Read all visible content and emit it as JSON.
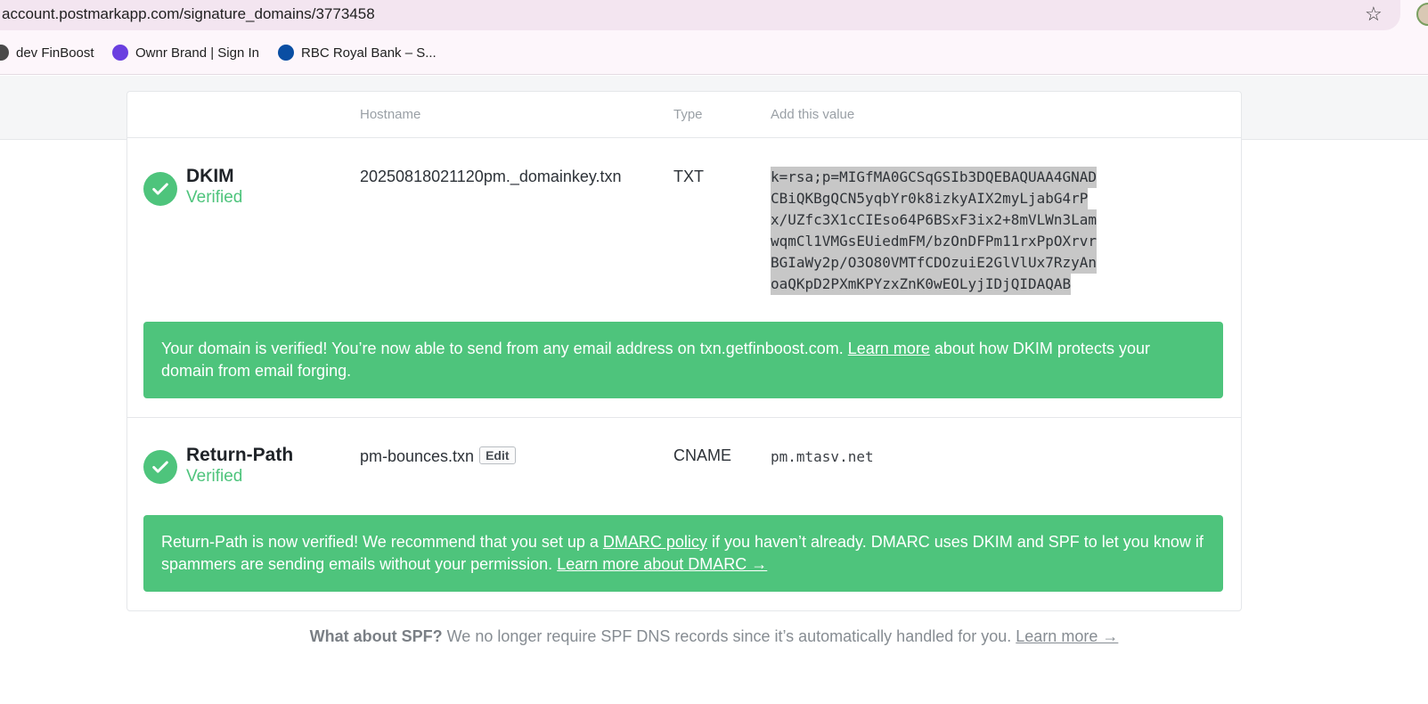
{
  "browser": {
    "url": "account.postmarkapp.com/signature_domains/3773458",
    "bookmarks": [
      {
        "label": "dev FinBoost",
        "icon": "globe-icon"
      },
      {
        "label": "Ownr Brand | Sign In",
        "icon": "ownr-icon"
      },
      {
        "label": "RBC Royal Bank – S...",
        "icon": "rbc-icon"
      }
    ]
  },
  "table": {
    "headers": {
      "hostname": "Hostname",
      "type": "Type",
      "value": "Add this value"
    }
  },
  "dkim": {
    "name": "DKIM",
    "status": "Verified",
    "hostname": "20250818021120pm._domainkey.txn",
    "type": "TXT",
    "value_lines": [
      "k=rsa;p=MIGfMA0GCSqGSIb3DQEBAQUAA4GNAD",
      "CBiQKBgQCN5yqbYr0k8izkyAIX2myLjabG4rP",
      "x/UZfc3X1cCIEso64P6BSxF3ix2+8mVLWn3Lam",
      "wqmCl1VMGsEUiedmFM/bzOnDFPm11rxPpOXrvr",
      "BGIaWy2p/O3O80VMTfCDOzuiE2GlVlUx7RzyAn",
      "oaQKpD2PXmKPYzxZnK0wEOLyjIDjQIDAQAB"
    ],
    "alert": {
      "text_before": "Your domain is verified! You’re now able to send from any email address on txn.getfinboost.com. ",
      "link": "Learn more",
      "text_after": " about how DKIM protects your domain from email forging."
    }
  },
  "return_path": {
    "name": "Return-Path",
    "status": "Verified",
    "hostname": "pm-bounces.txn",
    "edit_label": "Edit",
    "type": "CNAME",
    "value": "pm.mtasv.net",
    "alert": {
      "text_before": "Return-Path is now verified! We recommend that you set up a ",
      "link1": "DMARC policy",
      "text_middle": " if you haven’t already. DMARC uses DKIM and SPF to let you know if spammers are sending emails without your permission. ",
      "link2": "Learn more about DMARC →"
    }
  },
  "spf": {
    "question": "What about SPF?",
    "text": " We no longer require SPF DNS records since it’s automatically handled for you. ",
    "link": "Learn more →"
  },
  "colors": {
    "success": "#4ec47c"
  }
}
